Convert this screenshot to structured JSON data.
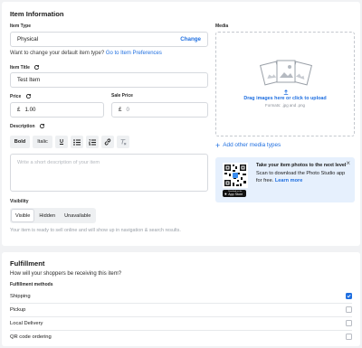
{
  "item_information": {
    "title": "Item Information",
    "item_type": {
      "label": "Item Type",
      "value": "Physical",
      "change_link": "Change",
      "hint": "Want to change your default item type?",
      "hint_link": "Go to Item Preferences"
    },
    "item_title": {
      "label": "Item Title",
      "value": "Test Item"
    },
    "price": {
      "label": "Price",
      "currency": "£",
      "value": "1.00"
    },
    "sale_price": {
      "label": "Sale Price",
      "currency": "£",
      "placeholder": "0"
    },
    "description": {
      "label": "Description",
      "toolbar": [
        "Bold",
        "Italic",
        "U",
        "list-bullet",
        "list-number",
        "link",
        "clear-format"
      ],
      "bold_label": "Bold",
      "italic_label": "Italic",
      "underline_label": "U",
      "placeholder": "Write a short description of your item"
    },
    "visibility": {
      "label": "Visibility",
      "options": [
        "Visible",
        "Hidden",
        "Unavailable"
      ],
      "selected": "Visible",
      "status": "Your item is ready to sell online and will show up in navigation & search results."
    },
    "media": {
      "label": "Media",
      "drag_text": "Drag images here or click to upload",
      "formats": "Formats: .jpg and .png",
      "add_media": "Add other media types"
    },
    "promo": {
      "title": "Take your item photos to the next level",
      "text": "Scan to download the Photo Studio app for free.",
      "link": "Learn more",
      "store_badge_small": "Download on the",
      "store_badge": "App Store"
    }
  },
  "fulfillment": {
    "title": "Fulfillment",
    "question": "How will your shoppers be receiving this item?",
    "methods_label": "Fulfillment methods",
    "methods": [
      {
        "label": "Shipping",
        "checked": true
      },
      {
        "label": "Pickup",
        "checked": false
      },
      {
        "label": "Local Delivery",
        "checked": false
      },
      {
        "label": "QR code ordering",
        "checked": false
      }
    ]
  },
  "colors": {
    "accent": "#1f6fe0",
    "promo_bg": "#e6f0fd",
    "page_bg": "#f1f2f4"
  }
}
